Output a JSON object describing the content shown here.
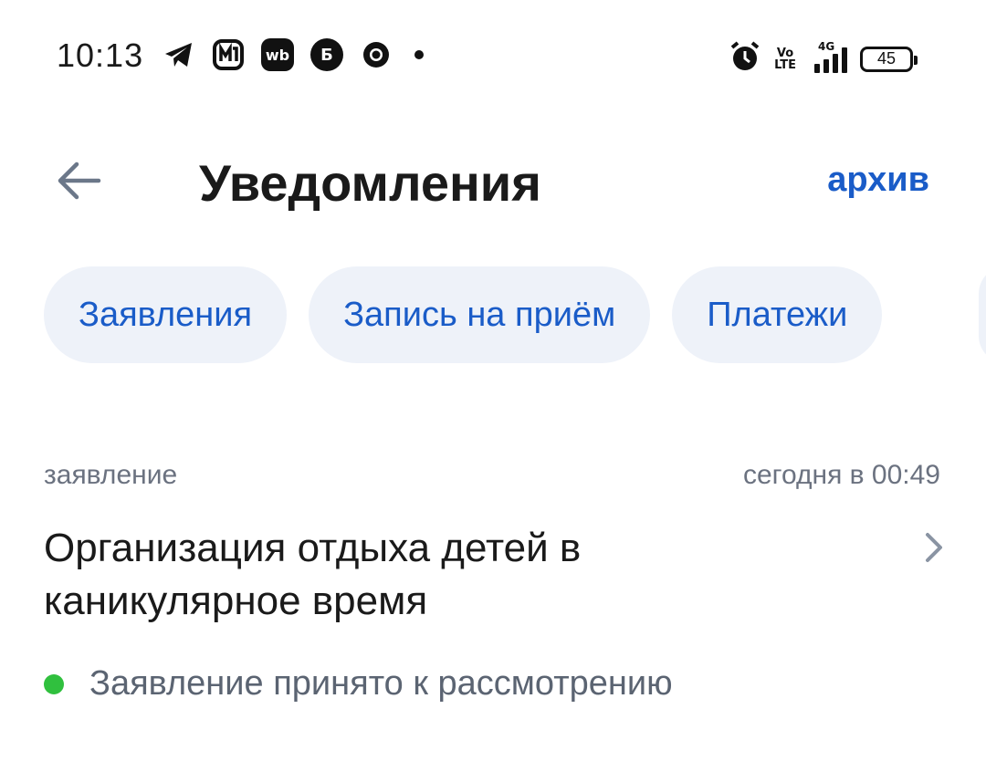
{
  "status_bar": {
    "time": "10:13",
    "app_icons": [
      "telegram-icon",
      "mts-icon",
      "wildberries-icon",
      "sber-icon",
      "chrome-icon"
    ],
    "wb_label": "wb",
    "sber_label": "Б",
    "volte_top": "Vo",
    "volte_bottom": "LTE",
    "network": "4G",
    "battery_level": "45"
  },
  "header": {
    "title": "Уведомления",
    "archive_label": "архив"
  },
  "filters": [
    {
      "label": "Заявления"
    },
    {
      "label": "Запись на приём"
    },
    {
      "label": "Платежи"
    }
  ],
  "notification": {
    "type": "заявление",
    "time": "сегодня в 00:49",
    "title": "Организация отдыха детей в каникулярное время",
    "status": "Заявление принято к рассмотрению",
    "status_color": "#30c03e"
  },
  "colors": {
    "accent": "#1a5cc8",
    "chip_bg": "#eef2f9"
  }
}
